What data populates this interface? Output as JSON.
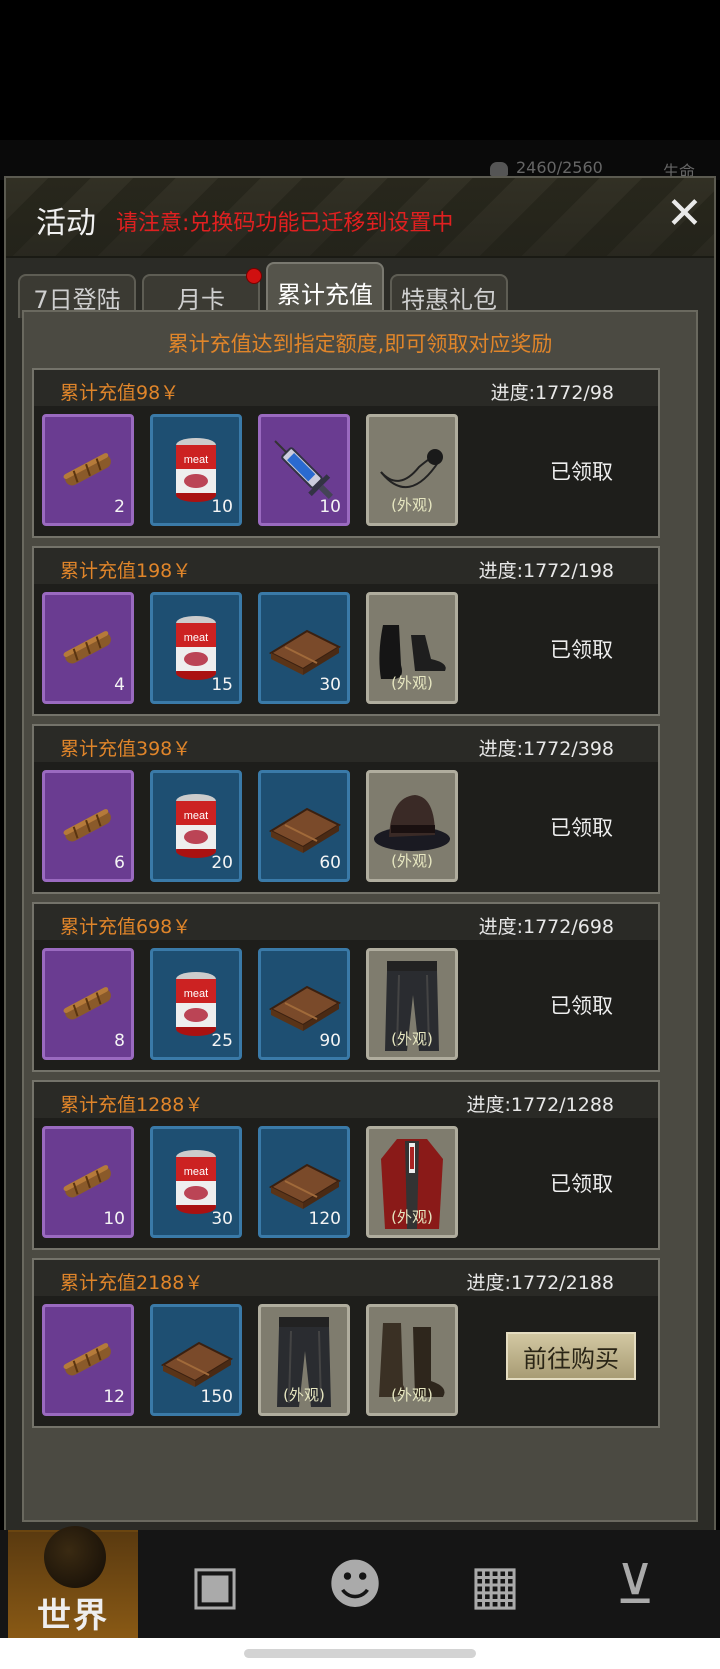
{
  "hud": {
    "hp_text": "2460/2560",
    "life_label": "生命"
  },
  "dialog": {
    "title": "活动",
    "notice": "请注意:兑换码功能已迁移到设置中",
    "close_icon": "close-icon"
  },
  "tabs": [
    {
      "label": "7日登陆",
      "active": false,
      "badge": false
    },
    {
      "label": "月卡",
      "active": false,
      "badge": true
    },
    {
      "label": "累计充值",
      "active": true,
      "badge": false
    },
    {
      "label": "特惠礼包",
      "active": false,
      "badge": false
    }
  ],
  "description": "累计充值达到指定额度,即可领取对应奖励",
  "rows": [
    {
      "label": "累计充值98￥",
      "progress": "进度:1772/98",
      "status": "已领取",
      "items": [
        {
          "icon": "cigar",
          "rarity": "purple",
          "qty": "2"
        },
        {
          "icon": "meat-can",
          "rarity": "blue",
          "qty": "10"
        },
        {
          "icon": "syringe",
          "rarity": "purple",
          "qty": "10"
        },
        {
          "icon": "eyepatch",
          "rarity": "gray",
          "qty": "",
          "look": "(外观)"
        }
      ]
    },
    {
      "label": "累计充值198￥",
      "progress": "进度:1772/198",
      "status": "已领取",
      "items": [
        {
          "icon": "cigar",
          "rarity": "purple",
          "qty": "4"
        },
        {
          "icon": "meat-can",
          "rarity": "blue",
          "qty": "15"
        },
        {
          "icon": "supply-box",
          "rarity": "blue",
          "qty": "30"
        },
        {
          "icon": "shoes",
          "rarity": "gray",
          "qty": "",
          "look": "(外观)"
        }
      ]
    },
    {
      "label": "累计充值398￥",
      "progress": "进度:1772/398",
      "status": "已领取",
      "items": [
        {
          "icon": "cigar",
          "rarity": "purple",
          "qty": "6"
        },
        {
          "icon": "meat-can",
          "rarity": "blue",
          "qty": "20"
        },
        {
          "icon": "supply-box",
          "rarity": "blue",
          "qty": "60"
        },
        {
          "icon": "hat",
          "rarity": "gray",
          "qty": "",
          "look": "(外观)"
        }
      ]
    },
    {
      "label": "累计充值698￥",
      "progress": "进度:1772/698",
      "status": "已领取",
      "items": [
        {
          "icon": "cigar",
          "rarity": "purple",
          "qty": "8"
        },
        {
          "icon": "meat-can",
          "rarity": "blue",
          "qty": "25"
        },
        {
          "icon": "supply-box",
          "rarity": "blue",
          "qty": "90"
        },
        {
          "icon": "trousers",
          "rarity": "gray",
          "qty": "",
          "look": "(外观)"
        }
      ]
    },
    {
      "label": "累计充值1288￥",
      "progress": "进度:1772/1288",
      "status": "已领取",
      "items": [
        {
          "icon": "cigar",
          "rarity": "purple",
          "qty": "10"
        },
        {
          "icon": "meat-can",
          "rarity": "blue",
          "qty": "30"
        },
        {
          "icon": "supply-box",
          "rarity": "blue",
          "qty": "120"
        },
        {
          "icon": "red-coat",
          "rarity": "gray",
          "qty": "",
          "look": "(外观)"
        }
      ]
    },
    {
      "label": "累计充值2188￥",
      "progress": "进度:1772/2188",
      "button": "前往购买",
      "items": [
        {
          "icon": "cigar",
          "rarity": "purple",
          "qty": "12"
        },
        {
          "icon": "supply-box",
          "rarity": "blue",
          "qty": "150"
        },
        {
          "icon": "trousers",
          "rarity": "gray",
          "qty": "",
          "look": "(外观)"
        },
        {
          "icon": "boots",
          "rarity": "gray",
          "qty": "",
          "look": "(外观)"
        }
      ]
    }
  ],
  "bottom_nav": [
    {
      "label": "世界",
      "icon": "globe-icon"
    },
    {
      "label": "",
      "icon": "backpack-icon"
    },
    {
      "label": "",
      "icon": "head-icon"
    },
    {
      "label": "",
      "icon": "calculator-icon"
    },
    {
      "label": "",
      "icon": "cart-icon"
    }
  ]
}
